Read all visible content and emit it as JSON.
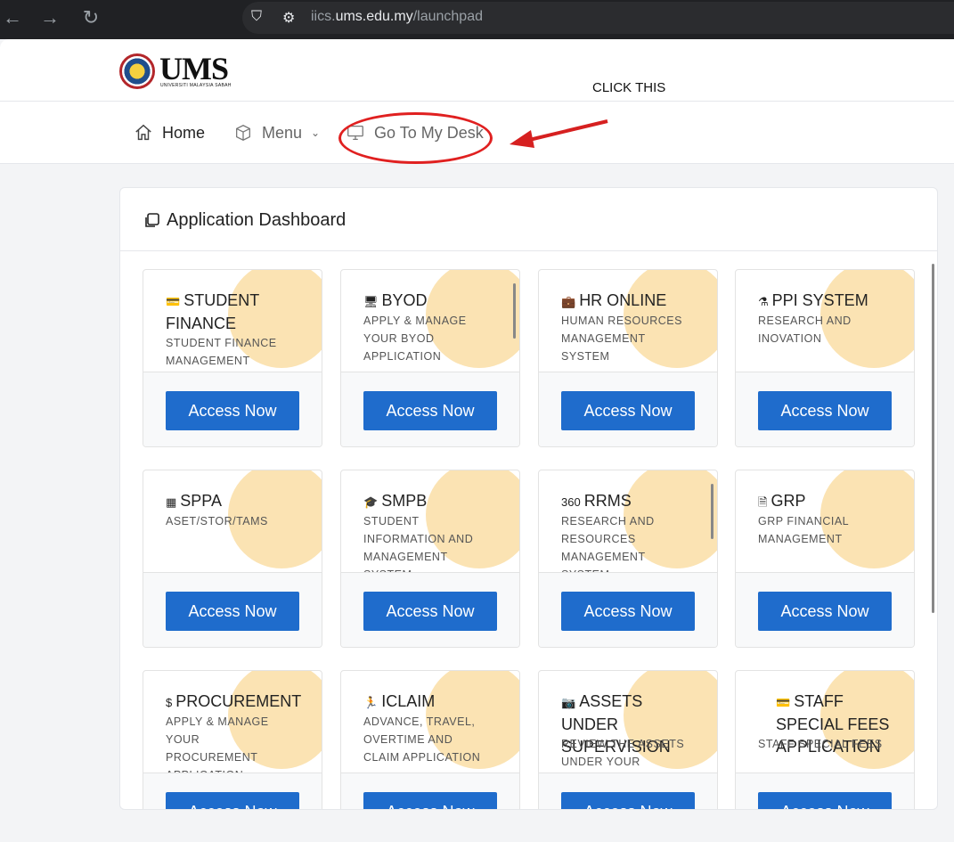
{
  "browser": {
    "url_plain": "iics.",
    "url_bold": "ums.edu.my",
    "url_path": "/launchpad"
  },
  "header": {
    "logo_text": "UMS",
    "logo_sub": "UNIVERSITI MALAYSIA SABAH",
    "annotation": "CLICK THIS"
  },
  "nav": {
    "home": "Home",
    "menu": "Menu",
    "desk": "Go To My Desk"
  },
  "dashboard": {
    "title": "Application Dashboard",
    "button_label": "Access Now"
  },
  "apps": [
    {
      "name": "STUDENT FINANCE",
      "desc": "STUDENT FINANCE MANAGEMENT",
      "icon": "💳"
    },
    {
      "name": "BYOD",
      "desc": "APPLY & MANAGE YOUR BYOD APPLICATION",
      "icon": "🖥"
    },
    {
      "name": "HR ONLINE",
      "desc": "HUMAN RESOURCES MANAGEMENT SYSTEM",
      "icon": "💼"
    },
    {
      "name": "PPI SYSTEM",
      "desc": "RESEARCH AND INOVATION",
      "icon": "⚗"
    },
    {
      "name": "SPPA",
      "desc": "ASET/STOR/TAMS",
      "icon": "▦"
    },
    {
      "name": "SMPB",
      "desc": "STUDENT INFORMATION AND MANAGEMENT SYSTEM",
      "icon": "🎓"
    },
    {
      "name": "RRMS",
      "desc": "RESEARCH AND RESOURCES MANAGEMENT SYSTEM",
      "icon": "360"
    },
    {
      "name": "GRP",
      "desc": "GRP FINANCIAL MANAGEMENT",
      "icon": "🗎"
    },
    {
      "name": "PROCUREMENT",
      "desc": "APPLY & MANAGE YOUR PROCUREMENT APPLICATION",
      "icon": "$"
    },
    {
      "name": "ICLAIM",
      "desc": "ADVANCE, TRAVEL, OVERTIME AND CLAIM APPLICATION",
      "icon": "🏃"
    },
    {
      "name": "ASSETS UNDER SUPERVISION",
      "desc": "REVIEW THE ASSETS UNDER YOUR",
      "icon": "📷"
    },
    {
      "name": "STAFF SPECIAL FEES APPLICATION",
      "desc": "STAFF SPECIAL FEES",
      "icon": "💳"
    }
  ]
}
